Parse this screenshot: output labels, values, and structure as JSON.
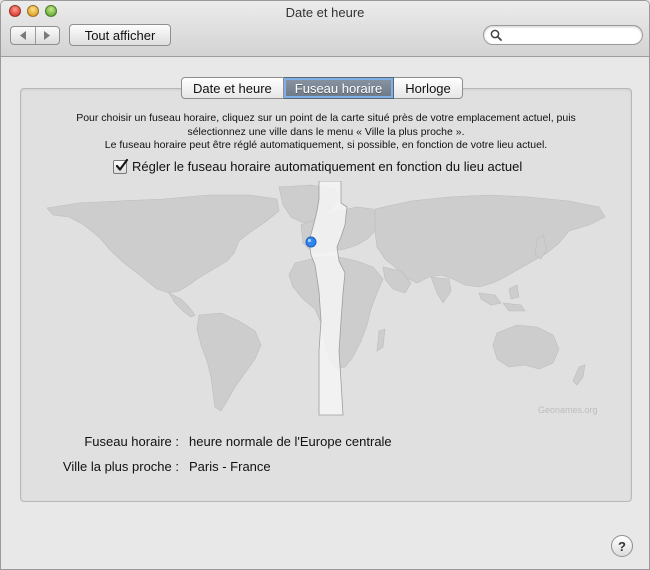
{
  "window": {
    "title": "Date et heure"
  },
  "toolbar": {
    "show_all_label": "Tout afficher",
    "back_icon": "chevron-left-icon",
    "forward_icon": "chevron-right-icon",
    "search_placeholder": ""
  },
  "tabs": [
    {
      "label": "Date et heure",
      "active": false
    },
    {
      "label": "Fuseau horaire",
      "active": true
    },
    {
      "label": "Horloge",
      "active": false
    }
  ],
  "instructions": {
    "line1": "Pour choisir un fuseau horaire, cliquez sur un point de la carte situé près de votre emplacement actuel, puis",
    "line2": "sélectionnez une ville dans le menu « Ville la plus proche ».",
    "line3": "Le fuseau horaire peut être réglé automatiquement, si possible, en fonction de votre lieu actuel."
  },
  "auto_timezone": {
    "label": "Régler le fuseau horaire automatiquement en fonction du lieu actuel",
    "checked": true
  },
  "map": {
    "credit": "Geonames.org"
  },
  "info": {
    "timezone_label": "Fuseau horaire :",
    "timezone_value": "heure normale de l'Europe centrale",
    "city_label": "Ville la plus proche :",
    "city_value": "Paris - France"
  },
  "help_label": "?",
  "colors": {
    "active_tab": "#6d7886",
    "pin": "#2f86f0",
    "land": "#cdcdcd",
    "highlight_zone": "#f4f4f4"
  }
}
